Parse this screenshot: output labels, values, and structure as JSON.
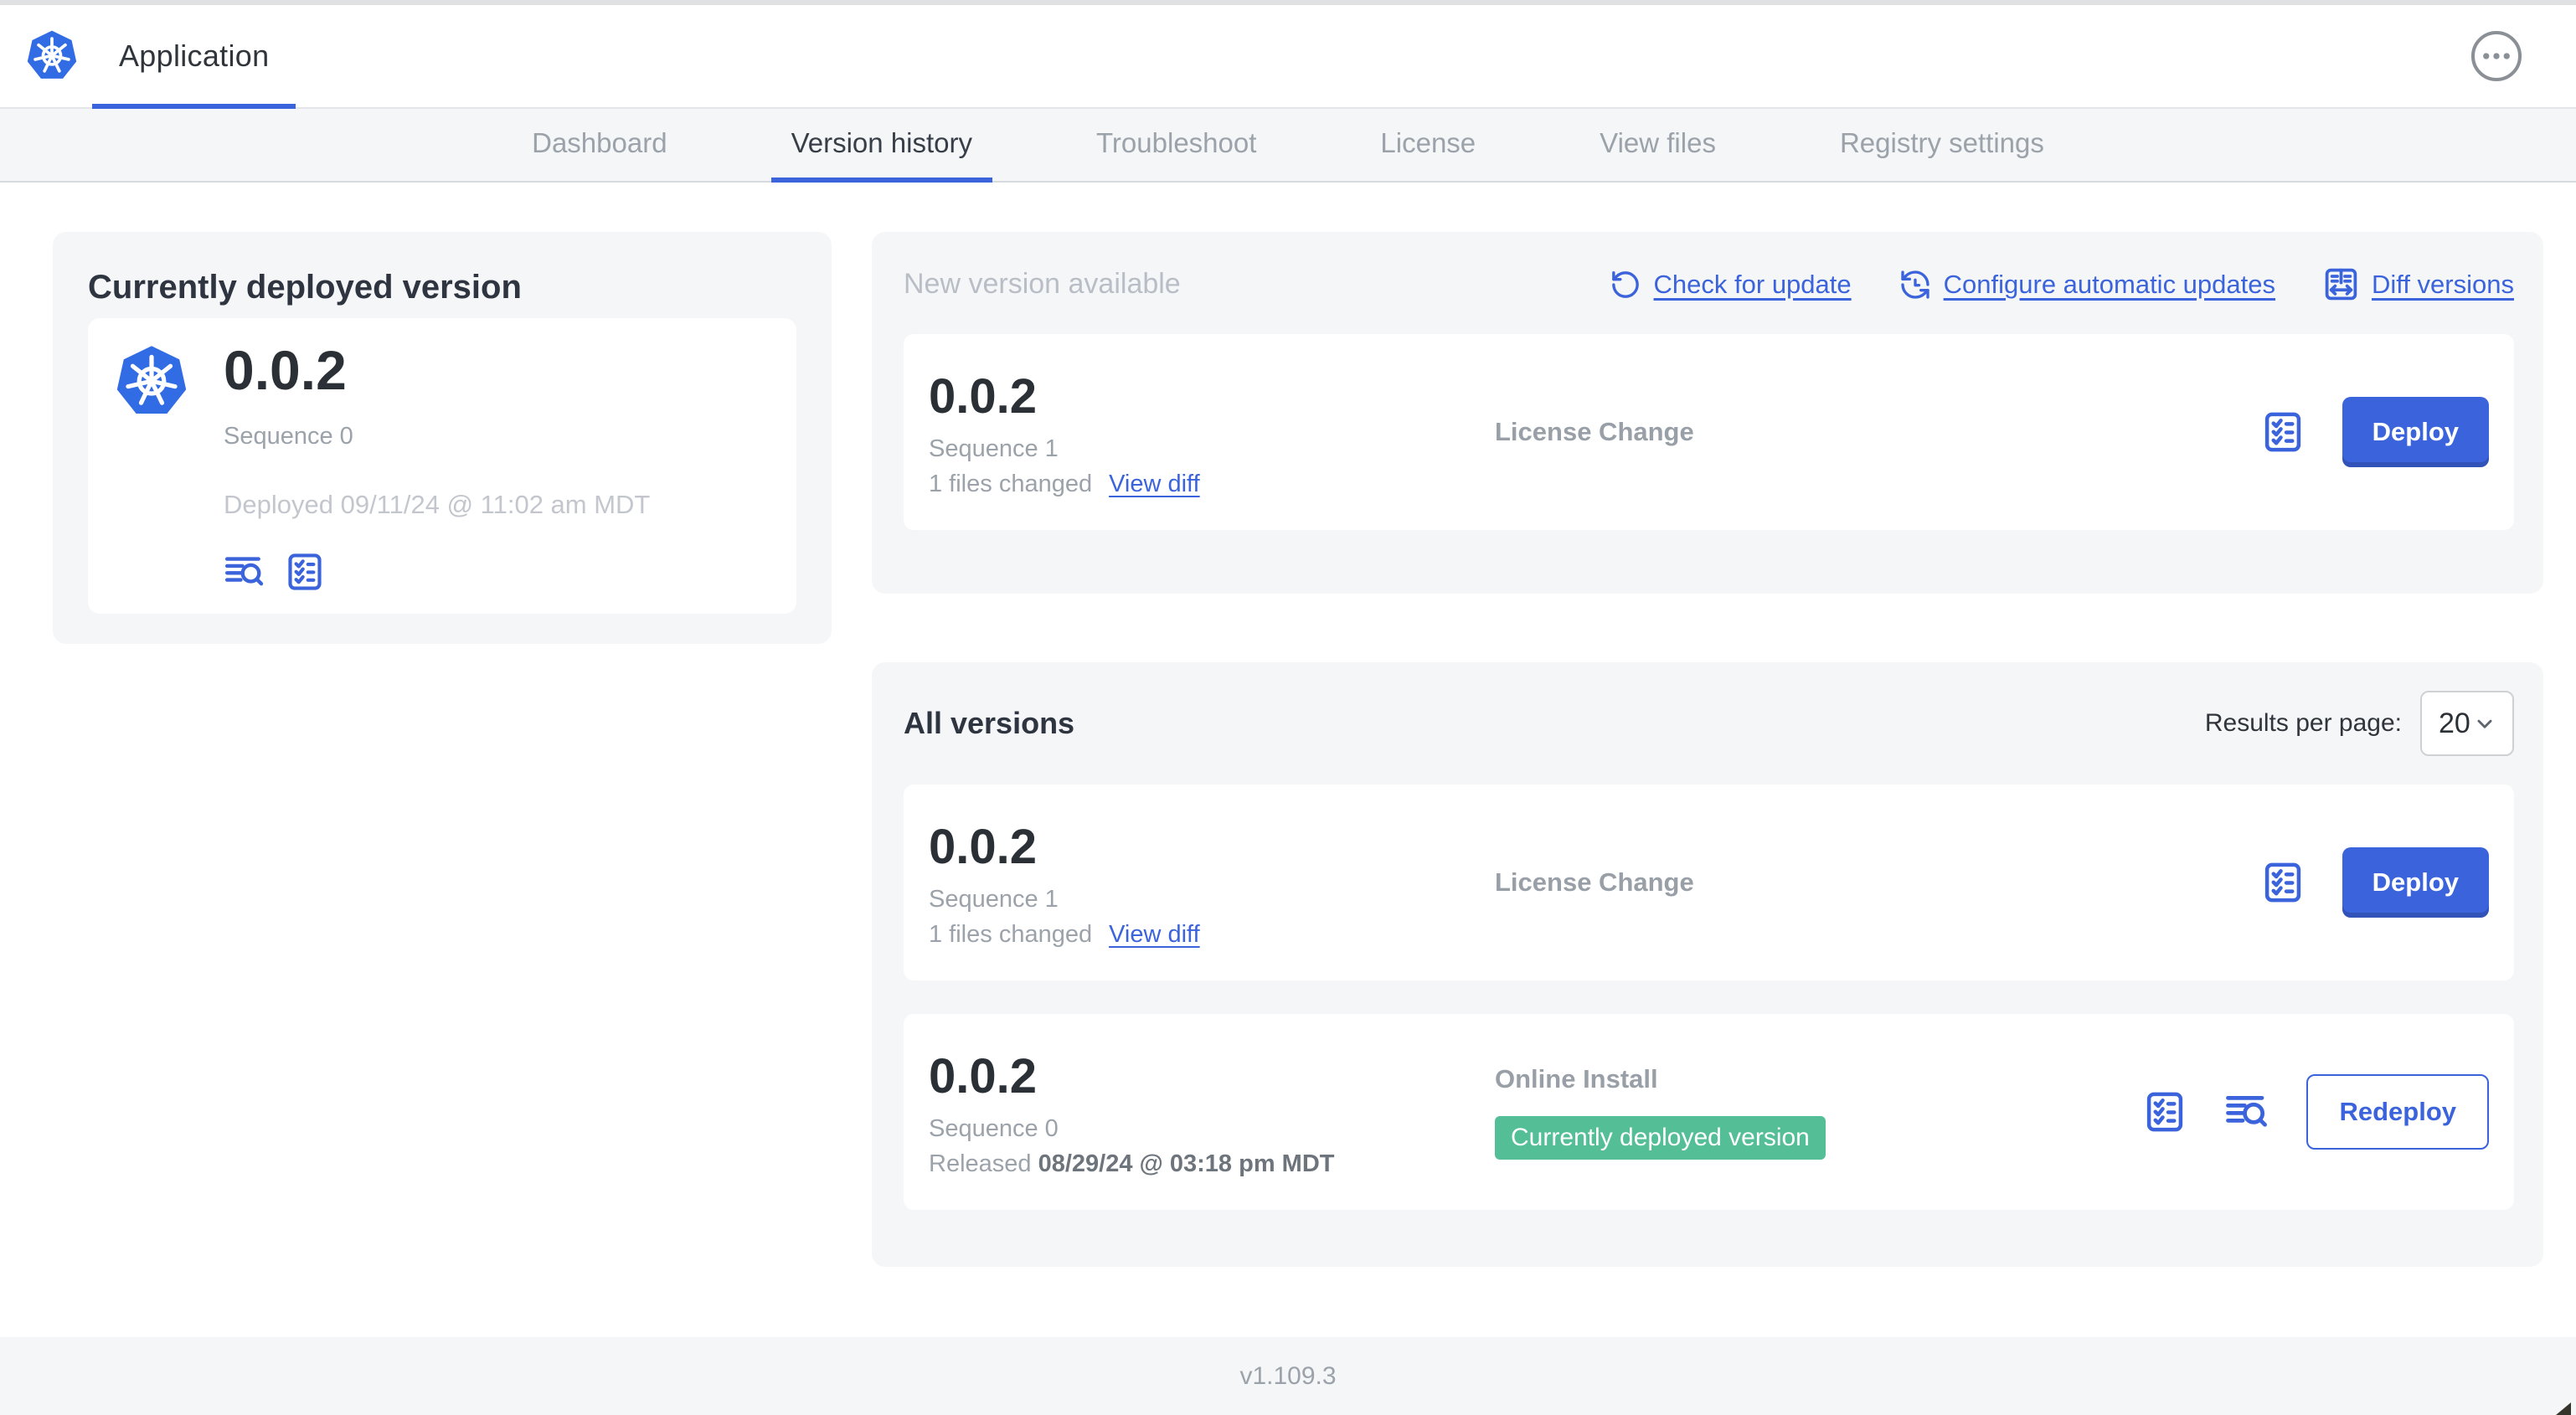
{
  "header": {
    "app_tab": "Application"
  },
  "nav": {
    "tabs": [
      {
        "label": "Dashboard",
        "active": false
      },
      {
        "label": "Version history",
        "active": true
      },
      {
        "label": "Troubleshoot",
        "active": false
      },
      {
        "label": "License",
        "active": false
      },
      {
        "label": "View files",
        "active": false
      },
      {
        "label": "Registry settings",
        "active": false
      }
    ]
  },
  "current_version_card": {
    "title": "Currently deployed version",
    "version": "0.0.2",
    "sequence": "Sequence 0",
    "deployed": "Deployed 09/11/24 @ 11:02 am MDT"
  },
  "new_version_card": {
    "title": "New version available",
    "actions": {
      "check_for_update": "Check for update",
      "configure_automatic_updates": "Configure automatic updates",
      "diff_versions": "Diff versions"
    },
    "row": {
      "version": "0.0.2",
      "sequence": "Sequence 1",
      "files_changed": "1 files changed",
      "view_diff": "View diff",
      "source": "License Change",
      "deploy_label": "Deploy"
    }
  },
  "all_versions_card": {
    "title": "All versions",
    "results_per_page_label": "Results per page:",
    "results_per_page_value": "20",
    "rows": [
      {
        "version": "0.0.2",
        "sequence": "Sequence 1",
        "files_changed": "1 files changed",
        "view_diff": "View diff",
        "source": "License Change",
        "deploy_label": "Deploy"
      },
      {
        "version": "0.0.2",
        "sequence": "Sequence 0",
        "released_prefix": "Released",
        "released_date": "08/29/24 @ 03:18 pm MDT",
        "source": "Online Install",
        "badge": "Currently deployed version",
        "deploy_label": "Redeploy"
      }
    ]
  },
  "footer": {
    "app_version": "v1.109.3"
  },
  "colors": {
    "accent_blue": "#3B63DB",
    "kubernetes_blue": "#326CE5",
    "badge_green": "#54BE97"
  }
}
